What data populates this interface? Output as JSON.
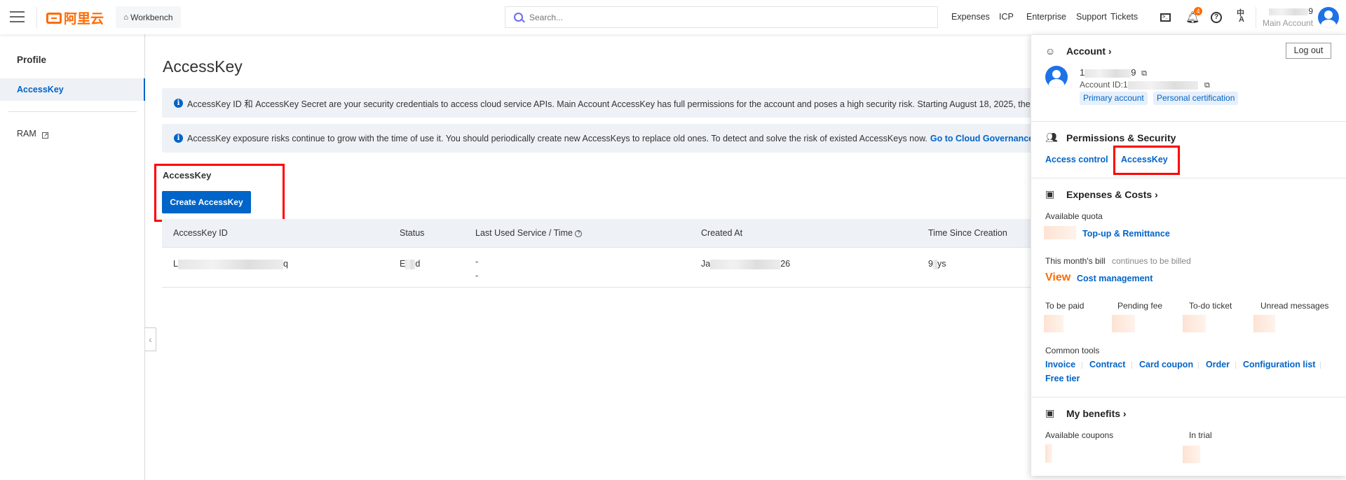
{
  "header": {
    "logo_text": "阿里云",
    "workbench_label": "Workbench",
    "search_placeholder": "Search...",
    "nav": [
      "Expenses",
      "ICP",
      "Enterprise",
      "Support",
      "Tickets"
    ],
    "notification_count": "4",
    "account_name_suffix": "9",
    "account_type": "Main Account",
    "brand_color": "#ff6a00"
  },
  "sidebar": {
    "title": "Profile",
    "items": [
      {
        "label": "AccessKey",
        "active": true
      },
      {
        "label": "RAM",
        "external": true
      }
    ]
  },
  "main": {
    "page_title": "AccessKey",
    "banners": [
      {
        "text": "AccessKey ID 和 AccessKey Secret are your security credentials to access cloud service APIs. Main Account AccessKey has full permissions for the account and poses a high security risk. Starting August 18, 2025, the quota for Acce"
      },
      {
        "text": "AccessKey exposure risks continue to grow with the time of use it. You should periodically create new AccessKeys to replace old ones. To detect and solve the risk of existed AccessKeys now.",
        "link": "Go to Cloud Governance for RAM"
      }
    ],
    "section_title": "AccessKey",
    "create_button": "Create AccessKey",
    "table": {
      "columns": [
        "AccessKey ID",
        "Status",
        "Last Used Service / Time",
        "Created At",
        "Time Since Creation"
      ],
      "rows": [
        {
          "id_start": "L",
          "id_end": "q",
          "status_start": "E",
          "status_end": "d",
          "last_used_1": "-",
          "last_used_2": "-",
          "created_start": "Ja",
          "created_end": "26",
          "since_start": "9",
          "since_end": "ys"
        }
      ]
    }
  },
  "panel": {
    "account_title": "Account",
    "logout": "Log out",
    "name_start": "1",
    "name_end": "9",
    "account_id_label": "Account ID:1",
    "tags": [
      "Primary account",
      "Personal certification"
    ],
    "permissions_title": "Permissions & Security",
    "permissions_links": [
      "Access control",
      "AccessKey"
    ],
    "expenses_title": "Expenses & Costs",
    "available_quota": "Available quota",
    "topup": "Top-up & Remittance",
    "bill_label": "This month's bill",
    "bill_status": "continues to be billed",
    "view": "View",
    "cost_management": "Cost management",
    "stats": [
      "To be paid",
      "Pending fee",
      "To-do ticket",
      "Unread messages"
    ],
    "common_tools": "Common tools",
    "tools": [
      "Invoice",
      "Contract",
      "Card coupon",
      "Order",
      "Configuration list",
      "Free tier"
    ],
    "benefits_title": "My benefits",
    "benefits": [
      "Available coupons",
      "In trial"
    ],
    "accent_color": "#ff6a00",
    "link_color": "#0064c8"
  }
}
